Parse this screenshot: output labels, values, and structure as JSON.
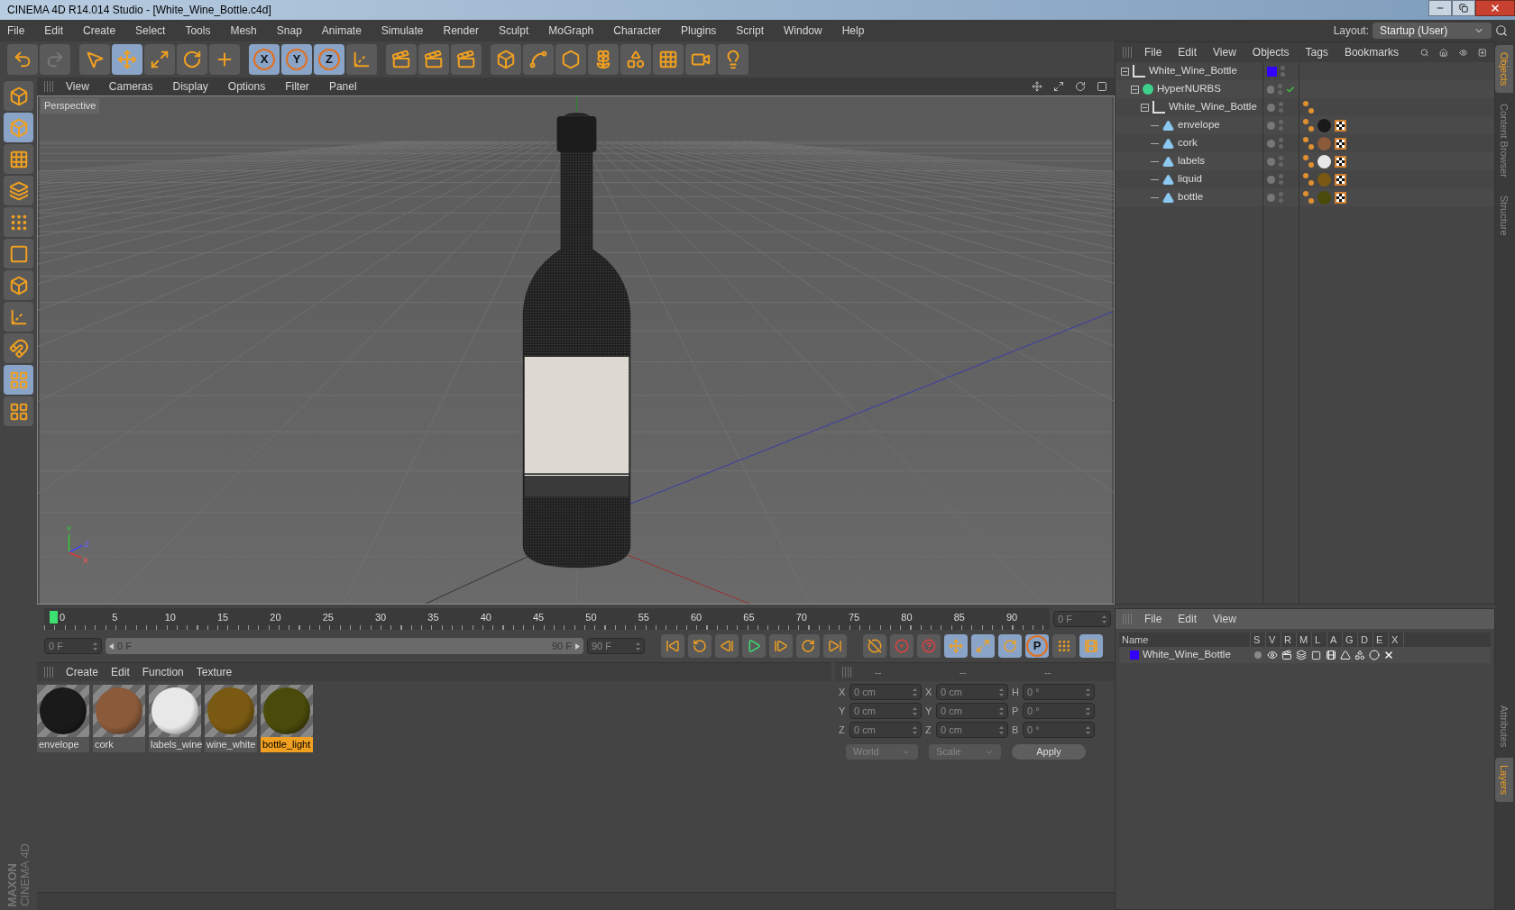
{
  "window": {
    "title": "CINEMA 4D R14.014 Studio - [White_Wine_Bottle.c4d]"
  },
  "menu": [
    "File",
    "Edit",
    "Create",
    "Select",
    "Tools",
    "Mesh",
    "Snap",
    "Animate",
    "Simulate",
    "Render",
    "Sculpt",
    "MoGraph",
    "Character",
    "Plugins",
    "Script",
    "Window",
    "Help"
  ],
  "layout": {
    "label": "Layout:",
    "value": "Startup (User)"
  },
  "toolbar": [
    {
      "kind": "undo",
      "selected": false
    },
    {
      "kind": "redo",
      "selected": false
    },
    {
      "kind": "select",
      "selected": false
    },
    {
      "kind": "move",
      "selected": true
    },
    {
      "kind": "scale",
      "selected": false
    },
    {
      "kind": "rotate",
      "selected": false
    },
    {
      "kind": "add",
      "selected": false
    },
    {
      "kind": "axis",
      "label": "X",
      "selected": true
    },
    {
      "kind": "axis",
      "label": "Y",
      "selected": true
    },
    {
      "kind": "axis",
      "label": "Z",
      "selected": true
    },
    {
      "kind": "coords",
      "selected": false
    },
    {
      "kind": "render",
      "selected": false
    },
    {
      "kind": "render",
      "selected": false
    },
    {
      "kind": "render",
      "selected": false
    },
    {
      "kind": "cube",
      "selected": false
    },
    {
      "kind": "spline",
      "selected": false
    },
    {
      "kind": "nurbs",
      "selected": false
    },
    {
      "kind": "array",
      "selected": false
    },
    {
      "kind": "deformer",
      "selected": false
    },
    {
      "kind": "floor",
      "selected": false
    },
    {
      "kind": "camera",
      "selected": false
    },
    {
      "kind": "light",
      "selected": false
    }
  ],
  "left_toolbar": [
    {
      "kind": "editable",
      "selected": false
    },
    {
      "kind": "model",
      "selected": true
    },
    {
      "kind": "texture",
      "selected": false
    },
    {
      "kind": "workplane",
      "selected": false
    },
    {
      "kind": "points",
      "selected": false
    },
    {
      "kind": "edges",
      "selected": false
    },
    {
      "kind": "polygons",
      "selected": false
    },
    {
      "kind": "axis",
      "selected": false
    },
    {
      "kind": "magnet",
      "selected": false
    },
    {
      "kind": "snap",
      "selected": true
    },
    {
      "kind": "snap-settings",
      "selected": false
    }
  ],
  "viewport": {
    "menu": [
      "View",
      "Cameras",
      "Display",
      "Options",
      "Filter",
      "Panel"
    ],
    "label": "Perspective",
    "gizmo_labels": [
      "Y",
      "Z",
      "X"
    ]
  },
  "timeline": {
    "ticks": [
      "0",
      "5",
      "10",
      "15",
      "20",
      "25",
      "30",
      "35",
      "40",
      "45",
      "50",
      "55",
      "60",
      "65",
      "70",
      "75",
      "80",
      "85",
      "90"
    ],
    "current_frame": "0 F",
    "start": "0 F",
    "range": {
      "start": "0 F",
      "end": "90 F",
      "level": 1
    },
    "end": "90 F"
  },
  "transport": [
    {
      "kind": "first"
    },
    {
      "kind": "loop-back"
    },
    {
      "kind": "step-back"
    },
    {
      "kind": "play"
    },
    {
      "kind": "step-forward"
    },
    {
      "kind": "loop"
    },
    {
      "kind": "last"
    }
  ],
  "key_tools": [
    {
      "kind": "record-off",
      "selected": false
    },
    {
      "kind": "record",
      "selected": false
    },
    {
      "kind": "help",
      "selected": false
    },
    {
      "kind": "move",
      "selected": true
    },
    {
      "kind": "scale",
      "selected": true
    },
    {
      "kind": "rotate",
      "selected": true
    },
    {
      "kind": "param",
      "label": "P",
      "selected": true
    },
    {
      "kind": "points",
      "selected": false
    },
    {
      "kind": "film",
      "selected": true
    }
  ],
  "materials": {
    "menu": [
      "Create",
      "Edit",
      "Function",
      "Texture"
    ],
    "items": [
      {
        "name": "envelope",
        "color": "#1a1a1a",
        "selected": false
      },
      {
        "name": "cork",
        "color": "#8a5a3a",
        "selected": false
      },
      {
        "name": "labels_wine",
        "color": "#e8e8e8",
        "selected": false
      },
      {
        "name": "wine_white",
        "color": "#7a5a12",
        "selected": false
      },
      {
        "name": "bottle_light",
        "color": "#4a4a0a",
        "selected": true
      }
    ]
  },
  "coordinates": {
    "headers": [
      "--",
      "--",
      "--"
    ],
    "rows": [
      {
        "axis": "X",
        "position": "0 cm",
        "size_axis": "X",
        "size": "0 cm",
        "rot_axis": "H",
        "rotation": "0 °"
      },
      {
        "axis": "Y",
        "position": "0 cm",
        "size_axis": "Y",
        "size": "0 cm",
        "rot_axis": "P",
        "rotation": "0 °"
      },
      {
        "axis": "Z",
        "position": "0 cm",
        "size_axis": "Z",
        "size": "0 cm",
        "rot_axis": "B",
        "rotation": "0 °"
      }
    ],
    "mode": "World",
    "size_mode": "Scale",
    "apply": "Apply"
  },
  "objects": {
    "menu": [
      "File",
      "Edit",
      "View",
      "Objects",
      "Tags",
      "Bookmarks"
    ],
    "tree": [
      {
        "name": "White_Wine_Bottle",
        "kind": "null",
        "color": "#3300ff",
        "children": [
          {
            "name": "HyperNURBS",
            "kind": "nurbs",
            "enabled": true,
            "children": [
              {
                "name": "White_Wine_Bottle",
                "kind": "null",
                "children": [
                  {
                    "name": "envelope",
                    "kind": "polygon",
                    "color": "#1a1a1a"
                  },
                  {
                    "name": "cork",
                    "kind": "polygon",
                    "color": "#8a5a3a"
                  },
                  {
                    "name": "labels",
                    "kind": "polygon",
                    "color": "#e8e8e8"
                  },
                  {
                    "name": "liquid",
                    "kind": "polygon",
                    "color": "#7a5a12"
                  },
                  {
                    "name": "bottle",
                    "kind": "polygon",
                    "color": "#4a4a0a"
                  }
                ]
              }
            ]
          }
        ]
      }
    ]
  },
  "layers": {
    "menu": [
      "File",
      "Edit",
      "View"
    ],
    "columns": [
      "Name",
      "S",
      "V",
      "R",
      "M",
      "L",
      "A",
      "G",
      "D",
      "E",
      "X"
    ],
    "rows": [
      {
        "name": "White_Wine_Bottle",
        "color": "#3300ff"
      }
    ]
  },
  "side_tabs_top": [
    {
      "label": "Objects",
      "selected": true
    },
    {
      "label": "Content Browser",
      "selected": false
    },
    {
      "label": "Structure",
      "selected": false
    }
  ],
  "side_tabs_bottom": [
    {
      "label": "Attributes",
      "selected": false
    },
    {
      "label": "Layers",
      "selected": true
    }
  ],
  "brand": {
    "company": "MAXON",
    "product": "CINEMA 4D"
  }
}
